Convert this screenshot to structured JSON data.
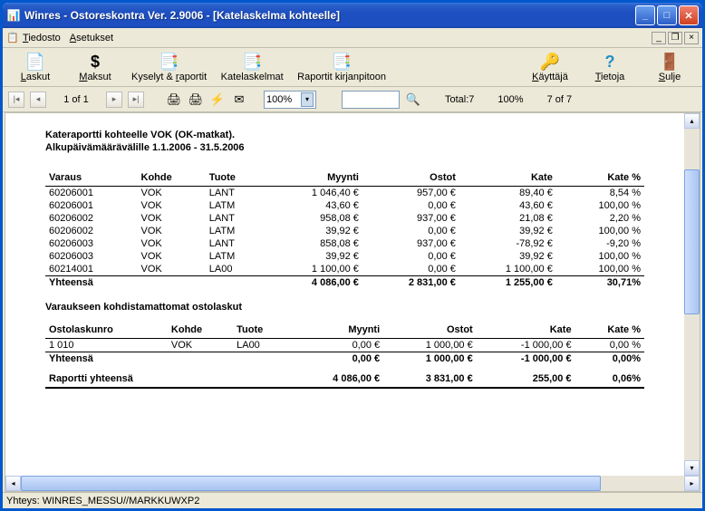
{
  "window": {
    "title": "Winres - Ostoreskontra Ver. 2.9006 - [Katelaskelma kohteelle]"
  },
  "menu": {
    "tiedosto": "Tiedosto",
    "asetukset": "Asetukset"
  },
  "toolbar": {
    "laskut": "Laskut",
    "maksut": "Maksut",
    "kyselyt": "Kyselyt & raportit",
    "katelaskelmat": "Katelaskelmat",
    "raportit": "Raportit kirjanpitoon",
    "kayttaja": "Käyttäjä",
    "tietoja": "Tietoja",
    "sulje": "Sulje"
  },
  "reportbar": {
    "page": "1 of 1",
    "zoom": "100%",
    "total_label": "Total:",
    "total": "7",
    "pct": "100%",
    "range": "7 of 7"
  },
  "report": {
    "header1": "Kateraportti kohteelle VOK (OK-matkat).",
    "header2": "Alkupäivämäärävälille 1.1.2006 - 31.5.2006",
    "cols1": [
      "Varaus",
      "Kohde",
      "Tuote",
      "Myynti",
      "Ostot",
      "Kate",
      "Kate %"
    ],
    "rows1": [
      [
        "60206001",
        "VOK",
        "LANT",
        "1 046,40 €",
        "957,00 €",
        "89,40 €",
        "8,54 %"
      ],
      [
        "60206001",
        "VOK",
        "LATM",
        "43,60 €",
        "0,00 €",
        "43,60 €",
        "100,00 %"
      ],
      [
        "60206002",
        "VOK",
        "LANT",
        "958,08 €",
        "937,00 €",
        "21,08 €",
        "2,20 %"
      ],
      [
        "60206002",
        "VOK",
        "LATM",
        "39,92 €",
        "0,00 €",
        "39,92 €",
        "100,00 %"
      ],
      [
        "60206003",
        "VOK",
        "LANT",
        "858,08 €",
        "937,00 €",
        "-78,92 €",
        "-9,20 %"
      ],
      [
        "60206003",
        "VOK",
        "LATM",
        "39,92 €",
        "0,00 €",
        "39,92 €",
        "100,00 %"
      ],
      [
        "60214001",
        "VOK",
        "LA00",
        "1 100,00 €",
        "0,00 €",
        "1 100,00 €",
        "100,00 %"
      ]
    ],
    "sum1_label": "Yhteensä",
    "sum1": [
      "4 086,00 €",
      "2 831,00 €",
      "1 255,00 €",
      "30,71%"
    ],
    "subhead": "Varaukseen kohdistamattomat ostolaskut",
    "cols2": [
      "Ostolaskunro",
      "Kohde",
      "Tuote",
      "Myynti",
      "Ostot",
      "Kate",
      "Kate %"
    ],
    "rows2": [
      [
        "1 010",
        "VOK",
        "LA00",
        "0,00 €",
        "1 000,00 €",
        "-1 000,00 €",
        "0,00 %"
      ]
    ],
    "sum2_label": "Yhteensä",
    "sum2": [
      "0,00 €",
      "1 000,00 €",
      "-1 000,00 €",
      "0,00%"
    ],
    "grand_label": "Raportti yhteensä",
    "grand": [
      "4 086,00 €",
      "3 831,00 €",
      "255,00 €",
      "0,06%"
    ]
  },
  "status": {
    "text": "Yhteys: WINRES_MESSU//MARKKUWXP2"
  }
}
